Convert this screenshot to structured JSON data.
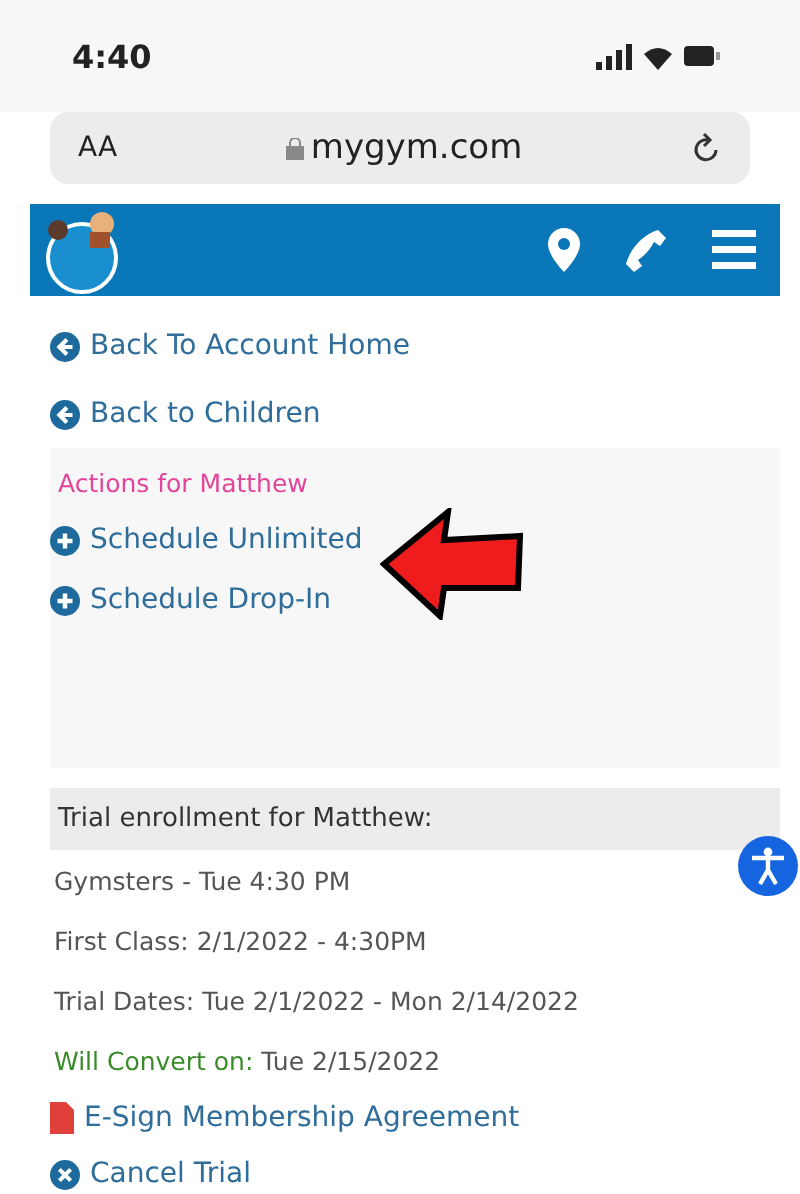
{
  "status_bar": {
    "time": "4:40"
  },
  "browser": {
    "text_size": "AA",
    "url": "mygym.com"
  },
  "nav_links": [
    {
      "label": "Back To Account Home",
      "kind": "back"
    },
    {
      "label": "Back to Children",
      "kind": "back"
    }
  ],
  "actions": {
    "title": "Actions for Matthew",
    "items": [
      {
        "label": "Schedule Unlimited",
        "kind": "add",
        "pointed": true
      },
      {
        "label": "Schedule Drop-In",
        "kind": "add",
        "pointed": false
      }
    ]
  },
  "trial": {
    "title": "Trial enrollment for Matthew:",
    "lines": [
      {
        "kind": "plain",
        "text": "Gymsters - Tue 4:30 PM"
      },
      {
        "kind": "plain",
        "text": "First Class: 2/1/2022 - 4:30PM"
      },
      {
        "kind": "plain",
        "text": "Trial Dates: Tue 2/1/2022 - Mon 2/14/2022"
      },
      {
        "kind": "convert",
        "label": "Will Convert on:",
        "text": "Tue 2/15/2022"
      }
    ],
    "links": [
      {
        "label": "E-Sign Membership Agreement",
        "kind": "document"
      },
      {
        "label": "Cancel Trial",
        "kind": "cancel"
      }
    ]
  }
}
